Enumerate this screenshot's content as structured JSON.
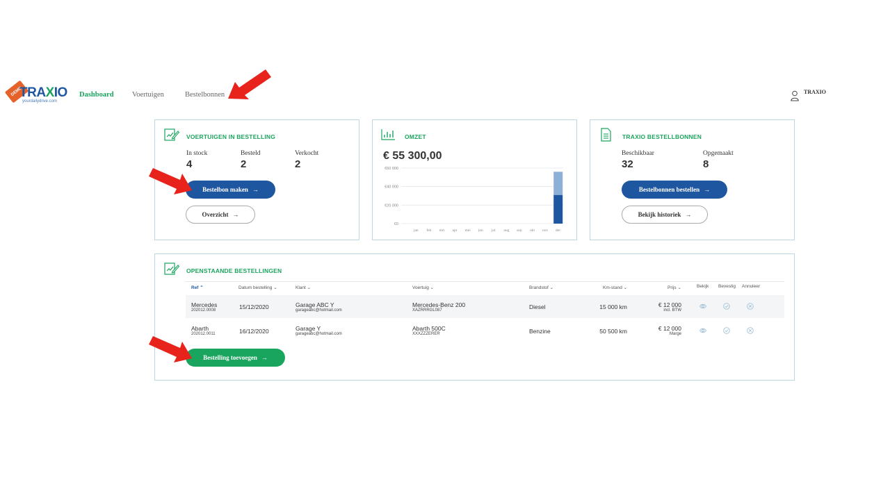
{
  "header": {
    "logo_text_pre": "TRA",
    "logo_text_x": "X",
    "logo_text_post": "IO",
    "logo_sub": "yourdailydrive.com",
    "logo_badge": "DEMO",
    "nav": [
      {
        "label": "Dashboard",
        "active": true
      },
      {
        "label": "Voertuigen",
        "active": false
      },
      {
        "label": "Bestelbonnen",
        "active": false
      }
    ],
    "user": "TRAXIO"
  },
  "vehicles_card": {
    "title": "Voertuigen in bestelling",
    "stats": [
      {
        "label": "In stock",
        "value": "4"
      },
      {
        "label": "Besteld",
        "value": "2"
      },
      {
        "label": "Verkocht",
        "value": "2"
      }
    ],
    "primary_button": "Bestelbon maken",
    "secondary_button": "Overzicht"
  },
  "omzet_card": {
    "title": "Omzet",
    "total": "€ 55 300,00"
  },
  "bestelbonnen_card": {
    "title": "Traxio bestellbonnen",
    "stats": [
      {
        "label": "Beschikbaar",
        "value": "32"
      },
      {
        "label": "Opgemaakt",
        "value": "8"
      }
    ],
    "primary_button": "Bestelbonnen bestellen",
    "secondary_button": "Bekijk historiek"
  },
  "chart_data": {
    "type": "bar",
    "categories": [
      "jan",
      "feb",
      "mrt",
      "apr",
      "mei",
      "jun",
      "jul",
      "aug",
      "sep",
      "okt",
      "nov",
      "dec"
    ],
    "series": [
      {
        "values": [
          0,
          0,
          0,
          0,
          0,
          0,
          0,
          0,
          0,
          0,
          0,
          31000
        ],
        "color": "#1f56a0"
      },
      {
        "values": [
          0,
          0,
          0,
          0,
          0,
          0,
          0,
          0,
          0,
          0,
          0,
          25000
        ],
        "color": "#8fb0d6"
      }
    ],
    "stacked": true,
    "yticks": [
      "€0",
      "€20 000",
      "€40 000",
      "€60 000"
    ],
    "ytick_values": [
      0,
      20000,
      40000,
      60000
    ],
    "ylim": [
      0,
      60000
    ],
    "grid": true
  },
  "orders_card": {
    "title": "Openstaande bestellingen",
    "columns": {
      "ref": "Ref",
      "datum": "Datum bestelling",
      "klant": "Klant",
      "voertuig": "Voertuig",
      "brandstof": "Brandstof",
      "km": "Km-stand",
      "prijs": "Prijs",
      "bekijk": "Bekijk",
      "bevestig": "Bevestig",
      "annuleer": "Annuleer"
    },
    "rows": [
      {
        "ref_main": "Mercedes",
        "ref_sub": "202012.0008",
        "datum": "15/12/2020",
        "klant_main": "Garage ABC Y",
        "klant_sub": "garageabc@hotmail.com",
        "voertuig_main": "Mercedes-Benz 200",
        "voertuig_sub": "XAZRRRGL087",
        "brandstof": "Diesel",
        "km": "15 000 km",
        "prijs_main": "€ 12 000",
        "prijs_sub": "incl. BTW"
      },
      {
        "ref_main": "Abarth",
        "ref_sub": "202012.0011",
        "datum": "16/12/2020",
        "klant_main": "Garage Y",
        "klant_sub": "garageabc@hotmail.com",
        "voertuig_main": "Abarth 500C",
        "voertuig_sub": "XXXZZZERER",
        "brandstof": "Benzine",
        "km": "50 500 km",
        "prijs_main": "€ 12 000",
        "prijs_sub": "Marge"
      }
    ],
    "add_button": "Bestelling toevoegen"
  },
  "colors": {
    "green": "#1aa55e",
    "blue": "#1f56a0",
    "annotation_red": "#e8231b"
  }
}
